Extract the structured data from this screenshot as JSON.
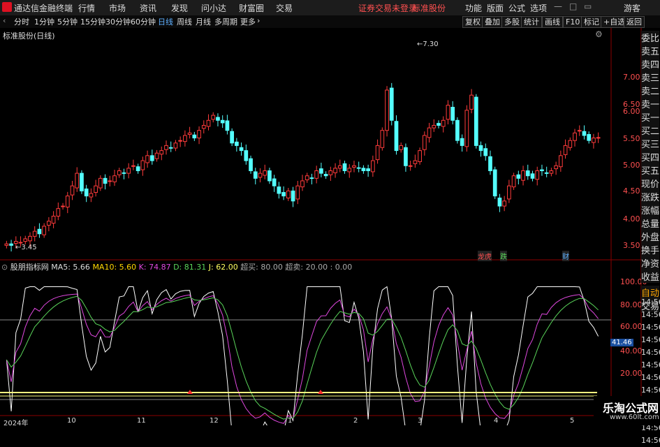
{
  "app_title": "通达信金融终端",
  "top_menu": [
    "行情",
    "市场",
    "资讯",
    "发现",
    "问小达",
    "财富圈",
    "交易"
  ],
  "login_warning": "证券交易未登录",
  "stock_name_title": "标准股份",
  "top_right": [
    "功能",
    "版面",
    "公式",
    "选项"
  ],
  "guest": "游客",
  "period_tabs": [
    "分时",
    "1分钟",
    "5分钟",
    "15分钟",
    "30分钟",
    "60分钟",
    "日线",
    "周线",
    "月线",
    "多周期",
    "更多"
  ],
  "active_period": "日线",
  "right_tools": [
    "复权",
    "叠加",
    "多股",
    "统计",
    "画线",
    "F10",
    "标记",
    "+自选",
    "返回"
  ],
  "chart_title": "标准股份(日线)",
  "price_ticks": [
    "7.00",
    "6.50",
    "6.00",
    "5.50",
    "5.00",
    "4.50",
    "4.00",
    "3.50"
  ],
  "max_label": "7.30",
  "min_label": "3.45",
  "side_labels": [
    "委比",
    "卖五",
    "卖四",
    "卖三",
    "卖二",
    "卖一",
    "买一",
    "买二",
    "买三",
    "买四",
    "买五",
    "现价",
    "涨跌",
    "涨幅",
    "总量",
    "外盘",
    "换手",
    "净资",
    "收益"
  ],
  "side_bottom": [
    "自动",
    "交易"
  ],
  "event_markers": [
    "龙虎",
    "跌",
    "财"
  ],
  "indicator_header": {
    "name": "股朋指标网",
    "ma5": "MA5: 5.66",
    "ma10": "MA10: 5.60",
    "k": "K: 74.87",
    "d": "D: 81.31",
    "j": "J: 62.00",
    "overbought": "超买: 80.00",
    "oversold": "超卖: 20.00 : 0.00"
  },
  "indicator_ticks": [
    "100.00",
    "80.00",
    "60.00",
    "40.00",
    "20.00"
  ],
  "indicator_cursor_value": "41.46",
  "time_labels": [
    "14:56",
    "14:56",
    "14:56",
    "14:56",
    "14:56",
    "14:56",
    "14:56",
    "14:56",
    "14:56",
    "14:56",
    "14:56",
    "14:56"
  ],
  "date_axis": [
    "2024年",
    "10",
    "11",
    "12",
    "1",
    "2",
    "3",
    "4",
    "5"
  ],
  "watermark": "乐淘公式网",
  "watermark_url": "www.60lt.com",
  "colors": {
    "up": "#ff3b3b",
    "down": "#54ffff",
    "k": "#ffffff",
    "d": "#e048e0",
    "j": "#5ad55a",
    "accent_blue": "#5fb0ff"
  },
  "chart_data": {
    "type": "candlestick",
    "title": "标准股份(日线)",
    "ylim": [
      3.4,
      7.5
    ],
    "closes_approx": [
      3.55,
      3.52,
      3.6,
      3.58,
      3.65,
      3.7,
      3.8,
      3.75,
      3.9,
      4.0,
      4.1,
      4.25,
      4.3,
      4.5,
      4.7,
      4.95,
      4.6,
      4.5,
      4.55,
      4.7,
      4.85,
      4.75,
      4.8,
      4.9,
      5.0,
      4.95,
      5.05,
      5.1,
      5.0,
      5.2,
      5.3,
      5.2,
      5.35,
      5.4,
      5.5,
      5.45,
      5.55,
      5.6,
      5.7,
      5.75,
      5.65,
      5.8,
      5.9,
      6.0,
      6.1,
      6.0,
      5.95,
      5.8,
      5.55,
      5.5,
      5.4,
      5.2,
      5.0,
      4.85,
      4.95,
      5.0,
      4.8,
      4.7,
      4.55,
      4.5,
      4.6,
      4.4,
      4.7,
      4.8,
      4.9,
      4.85,
      5.0,
      4.95,
      4.9,
      5.0,
      5.05,
      5.1,
      5.0,
      5.05,
      5.1,
      5.05,
      5.0,
      5.0,
      5.2,
      5.5,
      5.8,
      6.6,
      6.0,
      5.4,
      5.5,
      5.1,
      5.1,
      5.2,
      5.4,
      5.7,
      5.85,
      5.9,
      5.9,
      6.0,
      6.3,
      6.0,
      5.6,
      5.5,
      6.2,
      6.5,
      5.5,
      5.4,
      5.3,
      5.0,
      4.5,
      4.3,
      4.4,
      4.7,
      4.9,
      4.85,
      5.0,
      4.9,
      4.85,
      5.0,
      5.0,
      4.95,
      5.0,
      5.1,
      5.3,
      5.5,
      5.6,
      5.75,
      5.8,
      5.7,
      5.6,
      5.65,
      5.66
    ]
  }
}
